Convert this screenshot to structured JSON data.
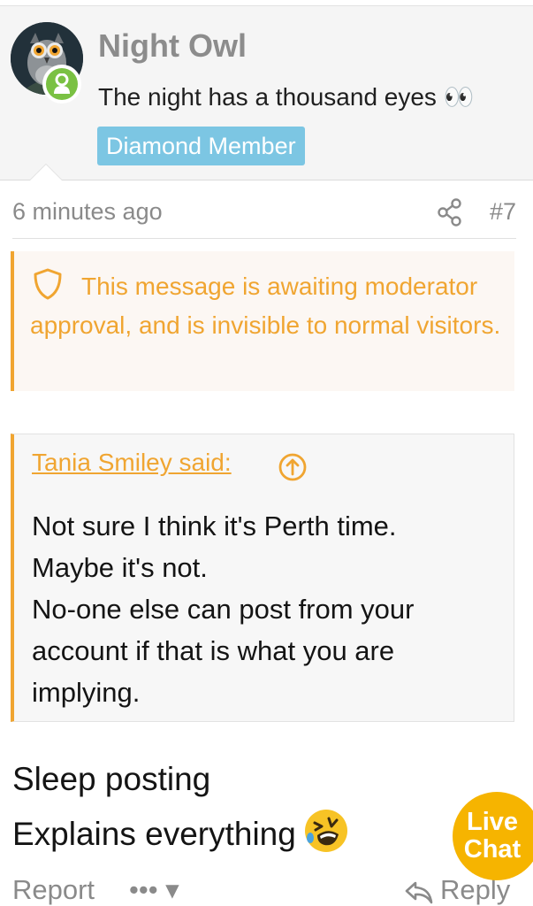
{
  "author": {
    "username": "Night Owl",
    "user_title": "The night has a thousand eyes 👀",
    "banner": "Diamond Member",
    "avatar_icon": "owl-avatar-icon",
    "status_icon": "user-online-icon"
  },
  "post": {
    "time": "6 minutes ago",
    "number": "#7",
    "share_icon": "share-icon"
  },
  "moderation": {
    "icon": "shield-icon",
    "text": "This message is awaiting moderator approval, and is invisible to normal visitors."
  },
  "quote": {
    "attribution": "Tania Smiley said:",
    "goto_icon": "arrow-up-circle-icon",
    "lines": [
      "Not sure I think it's Perth time.",
      "Maybe it's not.",
      "No-one else can post from your",
      "account if that is what you are",
      "implying."
    ]
  },
  "message": {
    "lines": [
      "Sleep posting",
      "Explains everything"
    ],
    "emoji": "rolling-laughing-emoji-icon"
  },
  "actions": {
    "report": "Report",
    "more": "••• ▾",
    "reply": "Reply"
  },
  "live_chat": {
    "line1": "Live",
    "line2": "Chat"
  },
  "colors": {
    "accent": "#f0a531",
    "banner": "#7cc6e3",
    "online": "#7ac143",
    "live_chat": "#f6b400"
  }
}
